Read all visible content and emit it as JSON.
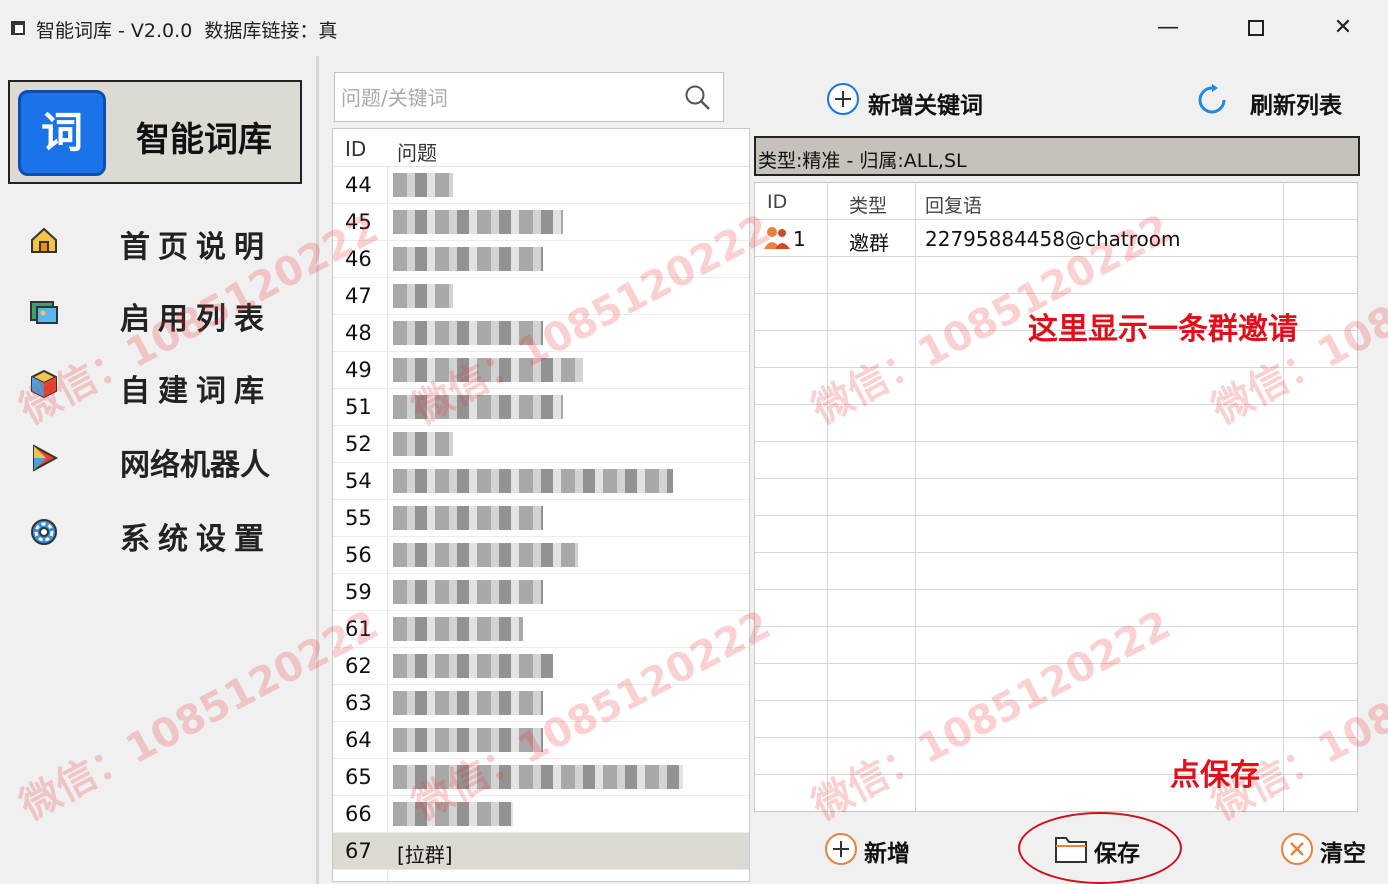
{
  "titlebar": {
    "title": "智能词库 - V2.0.0  数据库链接：真",
    "minimize": "—",
    "close": "✕"
  },
  "sidebar": {
    "logo_char": "词",
    "logo_title": "智能词库",
    "items": [
      {
        "label": "首页说明",
        "icon": "home-icon"
      },
      {
        "label": "启用列表",
        "icon": "image-list-icon"
      },
      {
        "label": "自建词库",
        "icon": "box-icon"
      },
      {
        "label": "网络机器人",
        "icon": "play-icon"
      },
      {
        "label": "系统设置",
        "icon": "gear-icon"
      }
    ]
  },
  "search": {
    "placeholder": "问题/关键词"
  },
  "question_list": {
    "headers": {
      "id": "ID",
      "question": "问题"
    },
    "rows": [
      {
        "id": "44"
      },
      {
        "id": "45"
      },
      {
        "id": "46"
      },
      {
        "id": "47"
      },
      {
        "id": "48"
      },
      {
        "id": "49"
      },
      {
        "id": "51"
      },
      {
        "id": "52"
      },
      {
        "id": "54"
      },
      {
        "id": "55"
      },
      {
        "id": "56"
      },
      {
        "id": "59"
      },
      {
        "id": "61"
      },
      {
        "id": "62"
      },
      {
        "id": "63"
      },
      {
        "id": "64"
      },
      {
        "id": "65"
      },
      {
        "id": "66"
      },
      {
        "id": "67",
        "text": "[拉群]",
        "selected": true
      }
    ]
  },
  "toolbar": {
    "add_keyword": "新增关键词",
    "refresh": "刷新列表"
  },
  "type_bar": "类型:精准 - 归属:ALL,SL",
  "reply_table": {
    "headers": {
      "id": "ID",
      "type": "类型",
      "reply": "回复语"
    },
    "rows": [
      {
        "id": "1",
        "type": "邀群",
        "reply": "22795884458@chatroom",
        "icon": "group-user-icon"
      }
    ]
  },
  "annotations": {
    "row_note": "这里显示一条群邀请",
    "save_note": "点保存"
  },
  "bottom": {
    "add": "新增",
    "save": "保存",
    "clear": "清空"
  },
  "watermark": "微信：1085120222",
  "colors": {
    "accent_blue": "#1a73e8",
    "annotation_red": "#e0101a",
    "selected_row": "#ddd9d3"
  }
}
